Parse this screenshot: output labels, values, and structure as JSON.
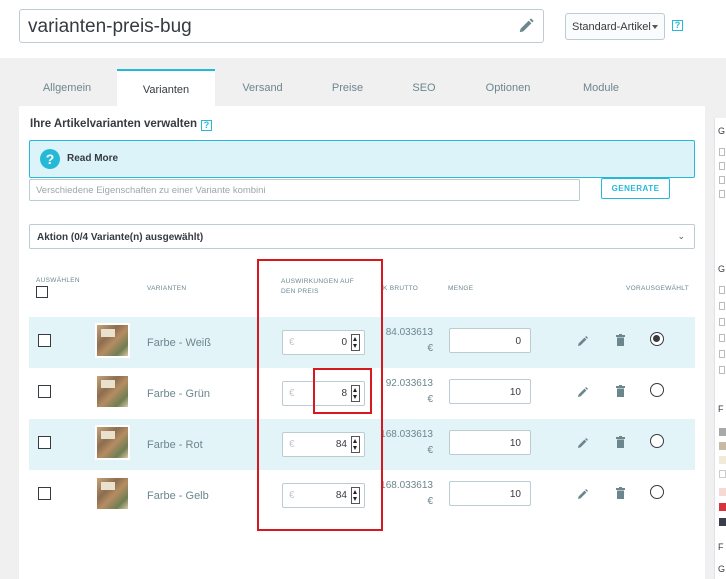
{
  "header": {
    "product_name": "varianten-preis-bug",
    "type_select": "Standard-Artikel",
    "help_glyph": "?"
  },
  "tabs": [
    {
      "label": "Allgemein",
      "active": false
    },
    {
      "label": "Varianten",
      "active": true
    },
    {
      "label": "Versand",
      "active": false
    },
    {
      "label": "Preise",
      "active": false
    },
    {
      "label": "SEO",
      "active": false
    },
    {
      "label": "Optionen",
      "active": false
    },
    {
      "label": "Module",
      "active": false
    }
  ],
  "variants_section": {
    "title": "Ihre Artikelvarianten verwalten",
    "info_label": "Read More",
    "combine_placeholder": "Verschiedene Eigenschaften zu einer Variante kombini",
    "generate_label": "GENERATE",
    "action_label": "Aktion (0/4 Variante(n) ausgewählt)"
  },
  "table": {
    "headers": {
      "select": "AUSWÄHLEN",
      "variants": "VARIANTEN",
      "impact_line1": "AUSWIRKUNGEN AUF",
      "impact_line2": "DEN PREIS",
      "brutto": "K BRUTTO",
      "qty": "MENGE",
      "default": "VORAUSGEWÄHLT"
    },
    "currency": "€",
    "rows": [
      {
        "name": "Farbe - Weiß",
        "impact": "0",
        "brutto": "84.033613",
        "brutto_cur": "€",
        "qty": "0",
        "default": true
      },
      {
        "name": "Farbe - Grün",
        "impact": "8",
        "brutto": "92.033613",
        "brutto_cur": "€",
        "qty": "10",
        "default": false
      },
      {
        "name": "Farbe - Rot",
        "impact": "84",
        "brutto": "168.033613",
        "brutto_cur": "€",
        "qty": "10",
        "default": false
      },
      {
        "name": "Farbe - Gelb",
        "impact": "84",
        "brutto": "168.033613",
        "brutto_cur": "€",
        "qty": "10",
        "default": false
      }
    ]
  },
  "right_strip": {
    "g1": "G",
    "g2": "G",
    "f1": "F",
    "f2": "F",
    "g3": "G"
  },
  "colors": {
    "accent": "#25b9d7",
    "highlight": "#d8181f",
    "row_alt": "#e3f4f8"
  }
}
